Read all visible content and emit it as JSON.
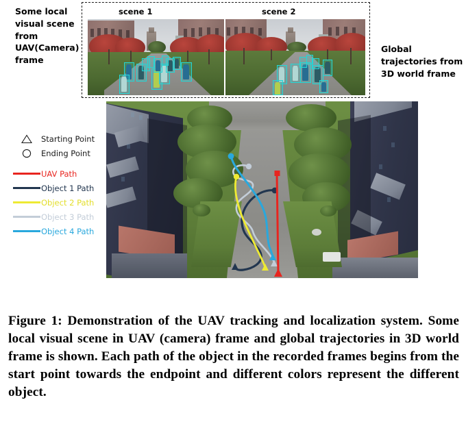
{
  "annotations": {
    "left_label": "Some local visual scene from UAV(Camera) frame",
    "right_label": "Global trajectories from 3D world frame"
  },
  "scene_panel": {
    "scene_1_label": "scene 1",
    "scene_2_label": "scene 2",
    "border_style": "dashed",
    "bbox_color": "#23d7d7"
  },
  "legend": {
    "marker_rows": [
      {
        "symbol": "triangle-outline",
        "label": "Starting Point",
        "color": "#1a1a1a"
      },
      {
        "symbol": "circle-outline",
        "label": "Ending Point",
        "color": "#1a1a1a"
      }
    ],
    "path_rows": [
      {
        "label": "UAV  Path",
        "color": "#e8251f"
      },
      {
        "label": "Object 1 Path",
        "color": "#22364f"
      },
      {
        "label": "Object 2 Path",
        "color": "#eeea33"
      },
      {
        "label": "Object 3 Path",
        "color": "#c3cdd8"
      },
      {
        "label": "Object 4 Path",
        "color": "#29a8dd"
      }
    ]
  },
  "chart_data": {
    "type": "line",
    "title": "Global trajectories from 3D world frame",
    "xlabel": "",
    "ylabel": "",
    "grid": false,
    "legend_position": "left-outside",
    "coordinate_note": "pixel coordinates within the 455x258 aerial view, origin top-left",
    "markers": {
      "start": "triangle",
      "end": "circle"
    },
    "series": [
      {
        "name": "UAV  Path",
        "color": "#e8251f",
        "start": [
          251,
          258
        ],
        "end": [
          249,
          105
        ],
        "points": [
          [
            249,
            105
          ],
          [
            250,
            150
          ],
          [
            250,
            200
          ],
          [
            251,
            240
          ],
          [
            251,
            258
          ]
        ]
      },
      {
        "name": "Object 1 Path",
        "color": "#22364f",
        "start": [
          188,
          242
        ],
        "end": [
          246,
          130
        ],
        "points": [
          [
            246,
            130
          ],
          [
            225,
            133
          ],
          [
            205,
            152
          ],
          [
            193,
            172
          ],
          [
            196,
            196
          ],
          [
            212,
            213
          ],
          [
            224,
            232
          ],
          [
            214,
            244
          ],
          [
            196,
            247
          ],
          [
            188,
            242
          ]
        ]
      },
      {
        "name": "Object 2 Path",
        "color": "#eeea33",
        "start": [
          232,
          243
        ],
        "end": [
          190,
          110
        ]
      },
      {
        "name": "Object 3 Path",
        "color": "#c3cdd8",
        "start": [
          245,
          237
        ],
        "end": [
          208,
          95
        ]
      },
      {
        "name": "Object 4 Path",
        "color": "#29a8dd",
        "start": [
          243,
          228
        ],
        "end": [
          182,
          80
        ]
      }
    ]
  },
  "caption": "Figure 1: Demonstration of the UAV tracking and localization system. Some local visual scene in UAV (camera) frame and global trajectories in 3D world frame is shown. Each path of the object in the recorded frames begins from the start point towards the endpoint and different colors represent the different object."
}
